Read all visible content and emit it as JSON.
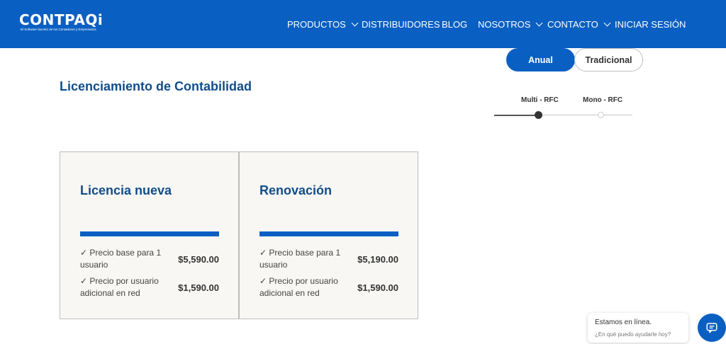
{
  "header": {
    "logo_text": "CONTPAQi",
    "logo_tagline": "El Software favorito de los Contadores y Empresarios",
    "nav": [
      {
        "label": "PRODUCTOS",
        "dropdown": true
      },
      {
        "label": "DISTRIBUIDORES",
        "dropdown": false
      },
      {
        "label": "BLOG",
        "dropdown": false
      },
      {
        "label": "NOSOTROS",
        "dropdown": true
      },
      {
        "label": "CONTACTO",
        "dropdown": true
      },
      {
        "label": "INICIAR SESIÓN",
        "dropdown": false
      }
    ]
  },
  "billing_toggle": {
    "options": [
      "Anual",
      "Tradicional"
    ],
    "selected": "Anual"
  },
  "page_title": "Licenciamiento de Contabilidad",
  "rfc_slider": {
    "options": [
      "Multi - RFC",
      "Mono - RFC"
    ],
    "selected": "Multi - RFC"
  },
  "cards": [
    {
      "title": "Licencia nueva",
      "rows": [
        {
          "label": "✓ Precio base para 1 usuario",
          "price": "$5,590.00"
        },
        {
          "label": "✓ Precio por usuario adicional en red",
          "price": "$1,590.00"
        }
      ]
    },
    {
      "title": "Renovación",
      "rows": [
        {
          "label": "✓ Precio base para 1 usuario",
          "price": "$5,190.00"
        },
        {
          "label": "✓ Precio por usuario adicional en red",
          "price": "$1,590.00"
        }
      ]
    }
  ],
  "chat": {
    "title": "Estamos en línea.",
    "subtitle": "¿En qué puedo ayudarle hoy?",
    "icon": "chat-icon"
  },
  "colors": {
    "primary": "#0a5fc2",
    "title": "#124d8a",
    "card_bg": "#f8f7f4"
  }
}
